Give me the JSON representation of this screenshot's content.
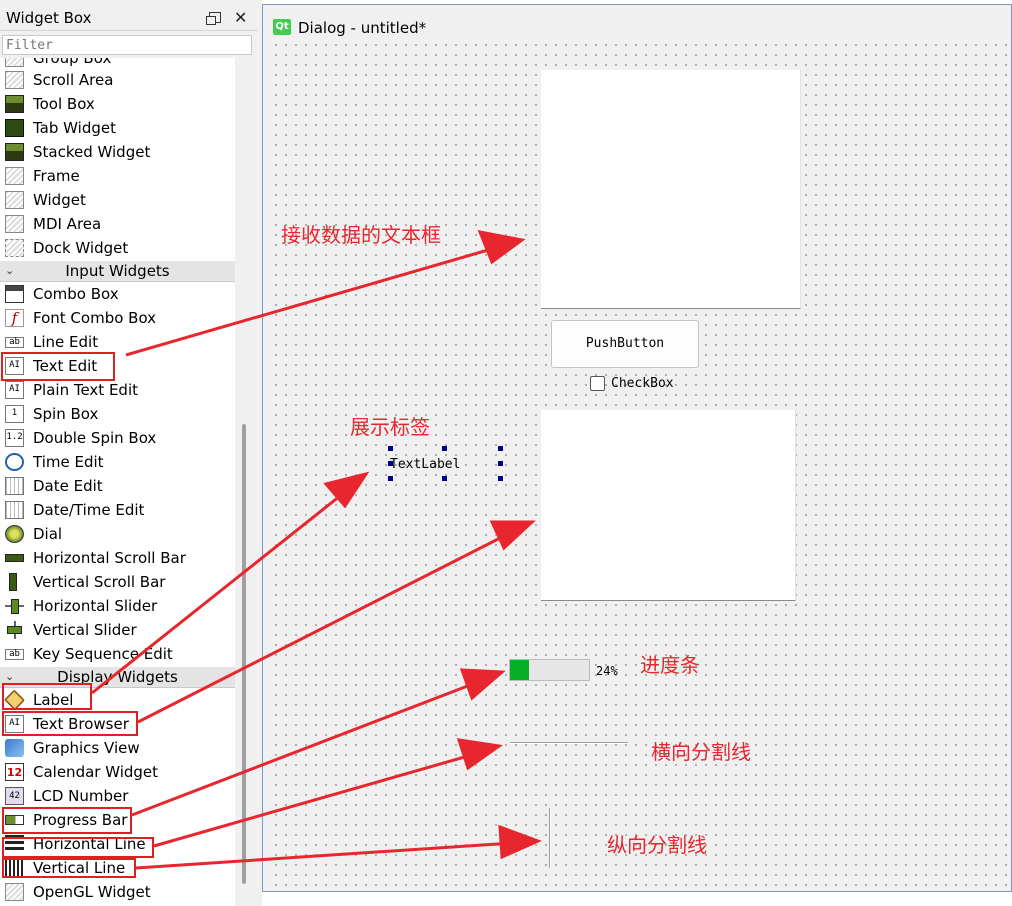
{
  "widget_box": {
    "title": "Widget Box",
    "filter_placeholder": "Filter",
    "items": [
      {
        "label": "Group Box",
        "icon": "group-box-icon"
      },
      {
        "label": "Scroll Area",
        "icon": "scroll-area-icon"
      },
      {
        "label": "Tool Box",
        "icon": "tool-box-icon"
      },
      {
        "label": "Tab Widget",
        "icon": "tab-widget-icon"
      },
      {
        "label": "Stacked Widget",
        "icon": "stacked-widget-icon"
      },
      {
        "label": "Frame",
        "icon": "frame-icon"
      },
      {
        "label": "Widget",
        "icon": "widget-icon"
      },
      {
        "label": "MDI Area",
        "icon": "mdi-area-icon"
      },
      {
        "label": "Dock Widget",
        "icon": "dock-widget-icon"
      }
    ],
    "input_category": "Input Widgets",
    "input_items": [
      {
        "label": "Combo Box",
        "icon": "combo-box-icon"
      },
      {
        "label": "Font Combo Box",
        "icon": "font-combo-box-icon"
      },
      {
        "label": "Line Edit",
        "icon": "line-edit-icon"
      },
      {
        "label": "Text Edit",
        "icon": "text-edit-icon"
      },
      {
        "label": "Plain Text Edit",
        "icon": "plain-text-edit-icon"
      },
      {
        "label": "Spin Box",
        "icon": "spin-box-icon"
      },
      {
        "label": "Double Spin Box",
        "icon": "double-spin-box-icon"
      },
      {
        "label": "Time Edit",
        "icon": "time-edit-icon"
      },
      {
        "label": "Date Edit",
        "icon": "date-edit-icon"
      },
      {
        "label": "Date/Time Edit",
        "icon": "date-time-edit-icon"
      },
      {
        "label": "Dial",
        "icon": "dial-icon"
      },
      {
        "label": "Horizontal Scroll Bar",
        "icon": "horizontal-scroll-bar-icon"
      },
      {
        "label": "Vertical Scroll Bar",
        "icon": "vertical-scroll-bar-icon"
      },
      {
        "label": "Horizontal Slider",
        "icon": "horizontal-slider-icon"
      },
      {
        "label": "Vertical Slider",
        "icon": "vertical-slider-icon"
      },
      {
        "label": "Key Sequence Edit",
        "icon": "key-sequence-edit-icon"
      }
    ],
    "display_category": "Display Widgets",
    "display_items": [
      {
        "label": "Label",
        "icon": "label-icon"
      },
      {
        "label": "Text Browser",
        "icon": "text-browser-icon"
      },
      {
        "label": "Graphics View",
        "icon": "graphics-view-icon"
      },
      {
        "label": "Calendar Widget",
        "icon": "calendar-widget-icon"
      },
      {
        "label": "LCD Number",
        "icon": "lcd-number-icon"
      },
      {
        "label": "Progress Bar",
        "icon": "progress-bar-icon"
      },
      {
        "label": "Horizontal Line",
        "icon": "horizontal-line-icon"
      },
      {
        "label": "Vertical Line",
        "icon": "vertical-line-icon"
      },
      {
        "label": "OpenGL Widget",
        "icon": "opengl-widget-icon"
      }
    ]
  },
  "dialog": {
    "qt_logo": "Qt",
    "title": "Dialog - untitled*",
    "push_button": "PushButton",
    "checkbox": "CheckBox",
    "text_label": "TextLabel",
    "progress_value": 24,
    "progress_text": "24%"
  },
  "annotations": {
    "text_edit": "接收数据的文本框",
    "label": "展示标签",
    "progress": "进度条",
    "hline": "横向分割线",
    "vline": "纵向分割线"
  },
  "colors": {
    "annotation_red": "#e8262e",
    "progress_green": "#06b025",
    "selection_handle": "#00008a"
  }
}
